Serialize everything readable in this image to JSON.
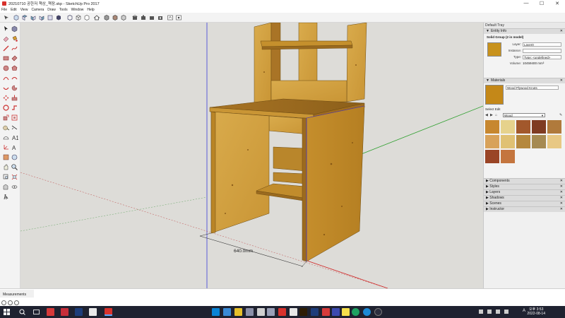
{
  "window": {
    "title": "20210710 공한저 책상_책장.skp - SketchUp Pro 2017",
    "buttons": [
      "—",
      "☐",
      "✕"
    ]
  },
  "menu": [
    "File",
    "Edit",
    "View",
    "Camera",
    "Draw",
    "Tools",
    "Window",
    "Help"
  ],
  "viewport": {
    "dimension_label": "640.0mm"
  },
  "tray": {
    "title": "Default Tray",
    "entity_info": {
      "header": "Entity Info",
      "heading": "Solid Group (2 in model)",
      "layer_label": "Layer:",
      "layer_value": "Layer0",
      "instance_label": "Instance:",
      "instance_value": "",
      "type_label": "Type:",
      "type_value": "Type: <undefined>",
      "volume_label": "Volume:",
      "volume_value": "10459400 mm³"
    },
    "materials": {
      "header": "Materials",
      "name": "Wood Plywood Knots",
      "tabs": "Select  Edit",
      "library": "Wood",
      "swatch_colors": [
        "#c7872f",
        "#e6d28c",
        "#a2582c",
        "#7f3b22",
        "#b07a3c",
        "#d8a25a",
        "#e0c173",
        "#b5883e",
        "#a68a52",
        "#e8c884",
        "#9a4526",
        "#c4753e"
      ]
    },
    "collapsed_panels": [
      "Components",
      "Styles",
      "Layers",
      "Shadows",
      "Scenes",
      "Instructor"
    ]
  },
  "status": {
    "measurements_label": "Measurements"
  },
  "taskbar": {
    "time": "오후 3:53",
    "date": "2022-08-14",
    "lang": "A"
  }
}
